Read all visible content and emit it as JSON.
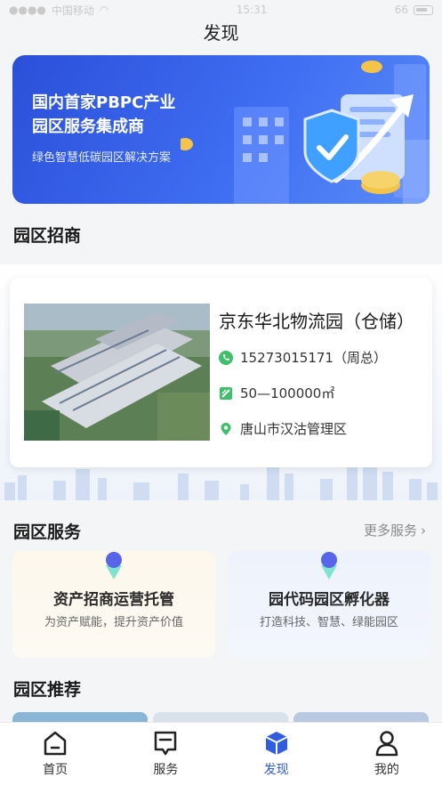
{
  "status_bar": {
    "carrier": "中国移动",
    "time": "15:31",
    "battery": "66"
  },
  "page_title": "发现",
  "banner": {
    "line1": "国内首家PBPC产业",
    "line2": "园区服务集成商",
    "subtitle": "绿色智慧低碳园区解决方案"
  },
  "recruit_section": {
    "title": "园区招商"
  },
  "park": {
    "name": "京东华北物流园（仓储）",
    "phone": "15273015171（周总）",
    "area": "50—100000㎡",
    "location": "唐山市汉沽管理区"
  },
  "service_section": {
    "title": "园区服务",
    "more_label": "更多服务"
  },
  "services": [
    {
      "title": "资产招商运营托管",
      "desc": "为资产赋能，提升资产价值"
    },
    {
      "title": "园代码园区孵化器",
      "desc": "打造科技、智慧、绿能园区"
    }
  ],
  "recommend_section": {
    "title": "园区推荐"
  },
  "tabs": [
    {
      "label": "首页",
      "icon": "home-icon"
    },
    {
      "label": "服务",
      "icon": "message-icon"
    },
    {
      "label": "发现",
      "icon": "cube-icon"
    },
    {
      "label": "我的",
      "icon": "user-icon"
    }
  ],
  "colors": {
    "accent": "#2f5ce0",
    "green": "#3fbf6b"
  }
}
